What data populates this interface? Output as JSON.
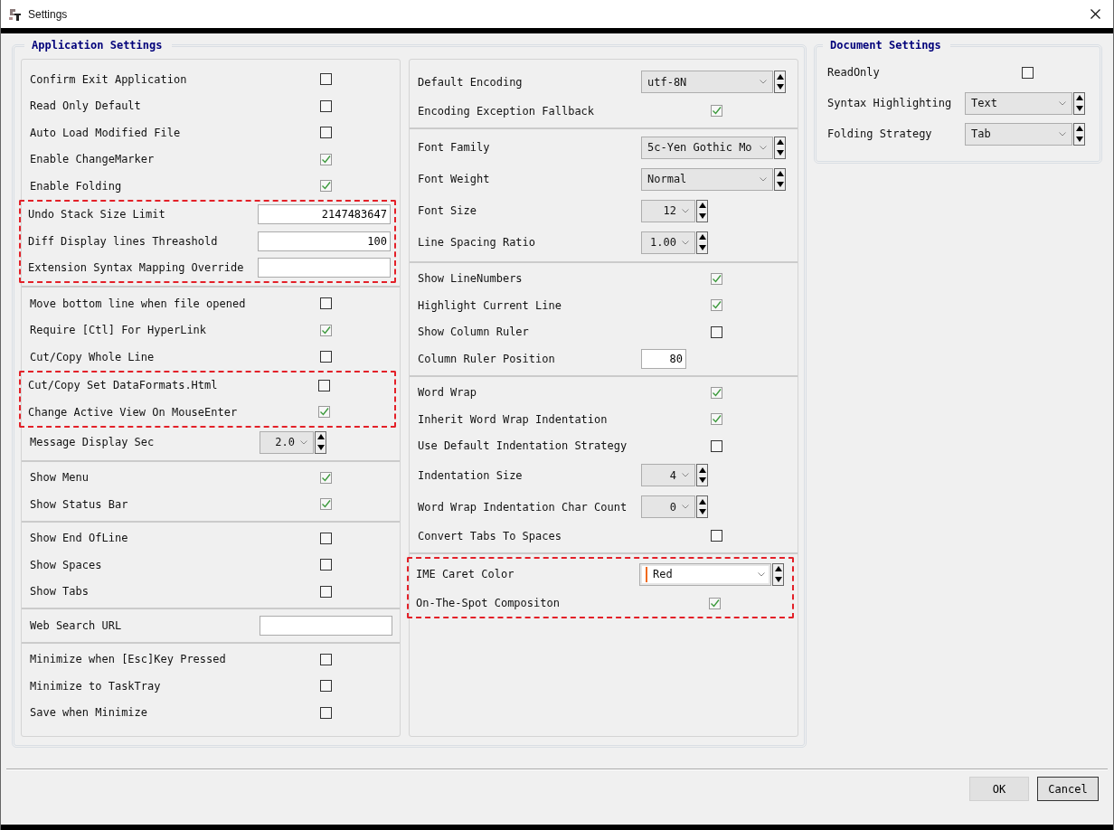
{
  "window": {
    "title": "Settings"
  },
  "application_settings": {
    "title": "Application Settings",
    "panels": [
      {
        "groups": [
          {
            "parts": [
              {
                "highlighted": false,
                "rows": [
                  {
                    "kind": "checkbox",
                    "label": "Confirm Exit Application",
                    "checked": false
                  },
                  {
                    "kind": "checkbox",
                    "label": "Read Only Default",
                    "checked": false
                  },
                  {
                    "kind": "checkbox",
                    "label": "Auto Load Modified File",
                    "checked": false
                  },
                  {
                    "kind": "checkbox",
                    "label": "Enable ChangeMarker",
                    "checked": true
                  },
                  {
                    "kind": "checkbox",
                    "label": "Enable Folding",
                    "checked": true
                  }
                ]
              },
              {
                "highlighted": true,
                "rows": [
                  {
                    "kind": "number",
                    "label": "Undo Stack Size Limit",
                    "value": "2147483647"
                  },
                  {
                    "kind": "number",
                    "label": "Diff Display lines Threashold",
                    "value": "100"
                  },
                  {
                    "kind": "text",
                    "label": "Extension Syntax Mapping Override"
                  }
                ]
              }
            ]
          },
          {
            "parts": [
              {
                "highlighted": false,
                "rows": [
                  {
                    "kind": "checkbox",
                    "label": "Move bottom line when file opened",
                    "checked": false
                  },
                  {
                    "kind": "checkbox",
                    "label": "Require [Ctl] For HyperLink",
                    "checked": true
                  },
                  {
                    "kind": "checkbox",
                    "label": "Cut/Copy Whole Line",
                    "checked": false
                  }
                ]
              },
              {
                "highlighted": true,
                "rows": [
                  {
                    "kind": "checkbox",
                    "label": "Cut/Copy Set DataFormats.Html",
                    "checked": false
                  },
                  {
                    "kind": "checkbox",
                    "label": "Change Active View On MouseEnter",
                    "checked": true
                  }
                ]
              },
              {
                "highlighted": false,
                "rows": [
                  {
                    "kind": "short-combo",
                    "label": "Message Display Sec",
                    "value": "2.0"
                  }
                ]
              }
            ]
          },
          {
            "parts": [
              {
                "highlighted": false,
                "rows": [
                  {
                    "kind": "checkbox",
                    "label": "Show Menu",
                    "checked": true
                  },
                  {
                    "kind": "checkbox",
                    "label": "Show Status Bar",
                    "checked": true
                  }
                ]
              }
            ]
          },
          {
            "parts": [
              {
                "highlighted": false,
                "rows": [
                  {
                    "kind": "checkbox",
                    "label": "Show End OfLine",
                    "checked": false
                  },
                  {
                    "kind": "checkbox",
                    "label": "Show Spaces",
                    "checked": false
                  },
                  {
                    "kind": "checkbox",
                    "label": "Show Tabs",
                    "checked": false
                  }
                ]
              }
            ]
          },
          {
            "parts": [
              {
                "highlighted": false,
                "rows": [
                  {
                    "kind": "text",
                    "label": "Web Search URL"
                  }
                ]
              }
            ]
          },
          {
            "parts": [
              {
                "highlighted": false,
                "rows": [
                  {
                    "kind": "checkbox",
                    "label": "Minimize when [Esc]Key Pressed",
                    "checked": false
                  },
                  {
                    "kind": "checkbox",
                    "label": "Minimize to TaskTray",
                    "checked": false
                  },
                  {
                    "kind": "checkbox",
                    "label": "Save when Minimize",
                    "checked": false
                  }
                ]
              }
            ]
          }
        ]
      },
      {
        "groups": [
          {
            "parts": [
              {
                "highlighted": false,
                "rows": [
                  {
                    "kind": "combo",
                    "label": "Default Encoding",
                    "value": "utf-8N"
                  },
                  {
                    "kind": "checkbox",
                    "label": "Encoding Exception Fallback",
                    "checked": true
                  }
                ]
              }
            ]
          },
          {
            "parts": [
              {
                "highlighted": false,
                "rows": [
                  {
                    "kind": "combo",
                    "label": "Font Family",
                    "value": "5c-Yen Gothic Mo"
                  },
                  {
                    "kind": "combo",
                    "label": "Font Weight",
                    "value": "Normal"
                  },
                  {
                    "kind": "short-combo",
                    "label": "Font Size",
                    "value": "12"
                  },
                  {
                    "kind": "short-combo",
                    "label": "Line Spacing Ratio",
                    "value": "1.00"
                  }
                ]
              }
            ]
          },
          {
            "parts": [
              {
                "highlighted": false,
                "rows": [
                  {
                    "kind": "checkbox",
                    "label": "Show LineNumbers",
                    "checked": true
                  },
                  {
                    "kind": "checkbox",
                    "label": "Highlight Current Line",
                    "checked": true
                  },
                  {
                    "kind": "checkbox",
                    "label": "Show Column Ruler",
                    "checked": false
                  },
                  {
                    "kind": "short-number",
                    "label": "Column Ruler Position",
                    "value": "80"
                  }
                ]
              }
            ]
          },
          {
            "parts": [
              {
                "highlighted": false,
                "rows": [
                  {
                    "kind": "checkbox",
                    "label": "Word Wrap",
                    "checked": true
                  },
                  {
                    "kind": "checkbox",
                    "label": "Inherit Word Wrap Indentation",
                    "checked": true
                  },
                  {
                    "kind": "checkbox",
                    "label": "Use Default Indentation Strategy",
                    "checked": false
                  },
                  {
                    "kind": "short-combo",
                    "label": "Indentation Size",
                    "value": "4"
                  },
                  {
                    "kind": "short-combo",
                    "label": "Word Wrap Indentation Char Count",
                    "value": "0"
                  },
                  {
                    "kind": "checkbox",
                    "label": "Convert Tabs To Spaces",
                    "checked": false
                  }
                ]
              }
            ]
          },
          {
            "parts": [
              {
                "highlighted": true,
                "rows": [
                  {
                    "kind": "color-combo",
                    "label": "IME Caret Color",
                    "value": "Red",
                    "color": "#f06a1e"
                  },
                  {
                    "kind": "checkbox",
                    "label": "On-The-Spot Compositon",
                    "checked": true
                  }
                ]
              }
            ]
          }
        ]
      }
    ]
  },
  "document_settings": {
    "title": "Document Settings",
    "panels": [
      {
        "groups": [
          {
            "parts": [
              {
                "highlighted": false,
                "rows": [
                  {
                    "kind": "checkbox",
                    "label": "ReadOnly",
                    "checked": false
                  },
                  {
                    "kind": "combo",
                    "label": "Syntax Highlighting",
                    "value": "Text"
                  },
                  {
                    "kind": "combo",
                    "label": "Folding Strategy",
                    "value": "Tab"
                  }
                ]
              }
            ]
          }
        ]
      }
    ]
  },
  "buttons": [
    {
      "label": "OK",
      "focused": false
    },
    {
      "label": "Cancel",
      "focused": true
    }
  ]
}
